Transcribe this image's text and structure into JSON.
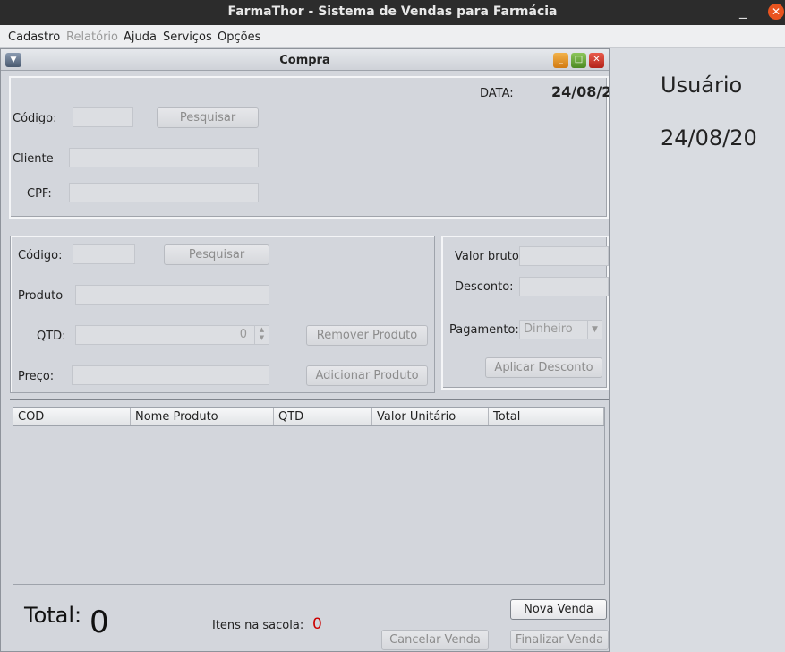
{
  "window": {
    "title": "FarmaThor - Sistema de Vendas para Farmácia",
    "minimize_glyph": "_",
    "close_glyph": "✕"
  },
  "menubar": {
    "items": [
      "Cadastro",
      "Relatório",
      "Ajuda",
      "Serviços",
      "Opções"
    ]
  },
  "side": {
    "user": "Usuário",
    "date": "24/08/20"
  },
  "frame": {
    "title": "Compra"
  },
  "client": {
    "data_label": "DATA:",
    "data_value": "24/08/2",
    "codigo_label": "Código:",
    "search_button": "Pesquisar",
    "cliente_label": "Cliente",
    "cpf_label": "CPF:"
  },
  "product": {
    "codigo_label": "Código:",
    "search_button": "Pesquisar",
    "produto_label": "Produto",
    "qtd_label": "QTD:",
    "qtd_value": "0",
    "preco_label": "Preço:",
    "remove_button": "Remover Produto",
    "add_button": "Adicionar Produto"
  },
  "values": {
    "valor_bruto_label": "Valor bruto",
    "desconto_label": "Desconto:",
    "pagamento_label": "Pagamento:",
    "pagamento_value": "Dinheiro",
    "apply_discount_button": "Aplicar Desconto"
  },
  "table": {
    "columns": [
      "COD",
      "Nome Produto",
      "QTD",
      "Valor Unitário",
      "Total"
    ]
  },
  "footer": {
    "total_label": "Total:",
    "total_value": "0",
    "itens_label": "Itens na sacola:",
    "itens_value": "0",
    "nova_venda_button": "Nova Venda",
    "cancelar_venda_button": "Cancelar Venda",
    "finalizar_venda_button": "Finalizar Venda"
  },
  "colors": {
    "titlebar": "#2c2c2c",
    "close": "#e9541f",
    "itens_value": "#cc0000"
  }
}
